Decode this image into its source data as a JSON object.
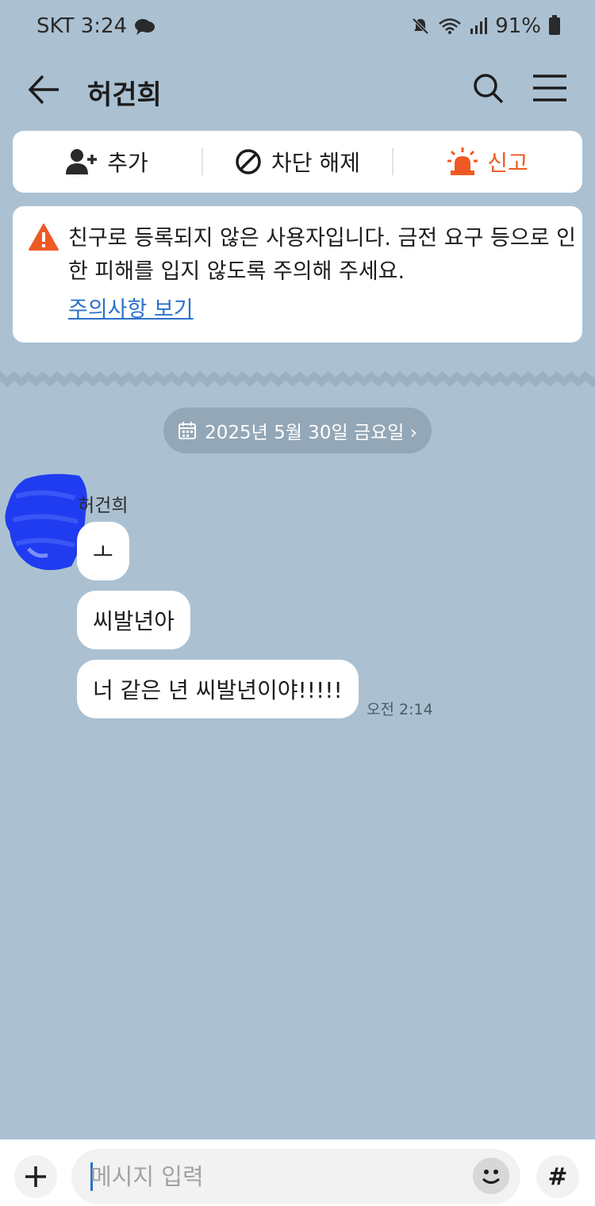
{
  "status_bar": {
    "carrier_time": "SKT 3:24",
    "battery": "91%"
  },
  "header": {
    "title": "허건희"
  },
  "actions": {
    "add_label": "추가",
    "unblock_label": "차단 해제",
    "report_label": "신고"
  },
  "warning": {
    "text": "친구로 등록되지 않은 사용자입니다. 금전 요구 등으로 인한 피해를 입지 않도록 주의해 주세요.",
    "link": "주의사항 보기"
  },
  "date_pill": {
    "label": "2025년 5월 30일 금요일 ›"
  },
  "conversation": {
    "sender": "허건희",
    "messages": [
      {
        "text": "ㅗ"
      },
      {
        "text": "씨발년아"
      },
      {
        "text": "너 같은 년 씨발년이야!!!!!"
      }
    ],
    "time": "오전 2:14"
  },
  "input": {
    "placeholder": "메시지 입력",
    "hash_label": "#"
  },
  "colors": {
    "background": "#abc1d2",
    "report_accent": "#ef5a24",
    "link": "#2a71c9",
    "avatar_scribble": "#1f3cf0"
  }
}
